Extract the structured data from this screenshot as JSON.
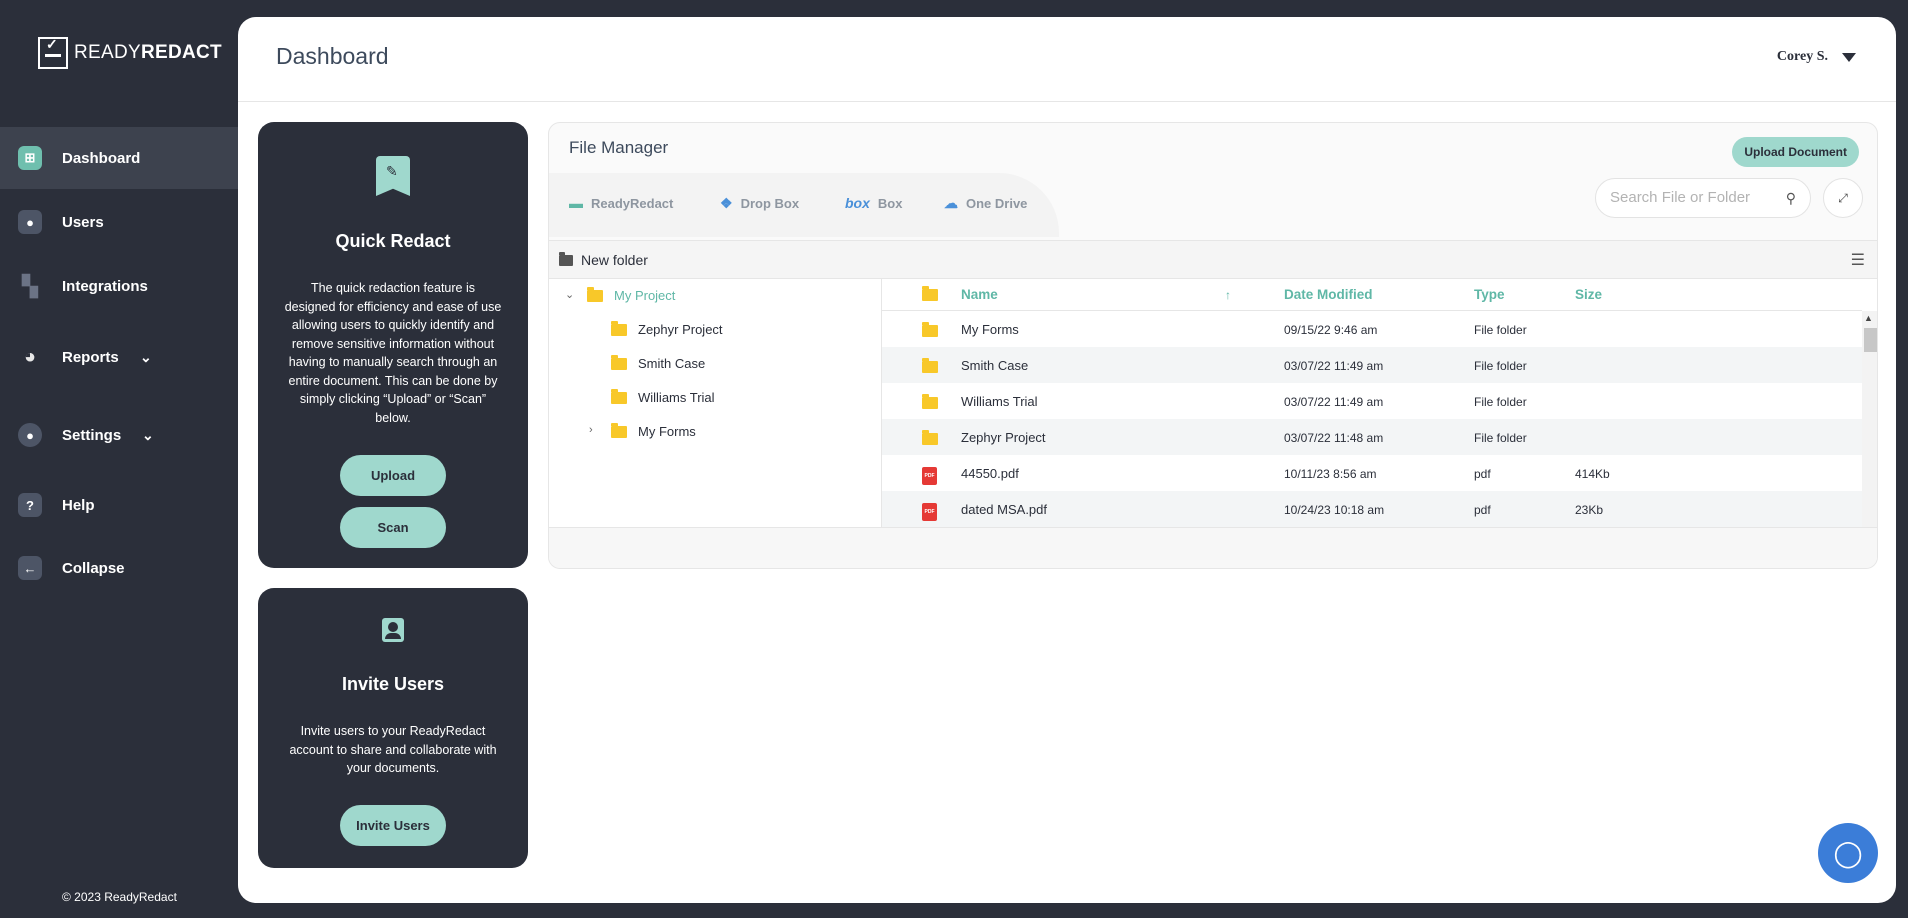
{
  "brand": {
    "name_regular": "READY",
    "name_bold": "REDACT"
  },
  "sidebar": {
    "items": [
      {
        "label": "Dashboard",
        "icon": "dashboard-icon",
        "active": true
      },
      {
        "label": "Users",
        "icon": "users-icon"
      },
      {
        "label": "Integrations",
        "icon": "integrations-icon"
      },
      {
        "label": "Reports",
        "icon": "reports-icon",
        "expandable": true
      },
      {
        "label": "Settings",
        "icon": "settings-icon",
        "expandable": true
      },
      {
        "label": "Help",
        "icon": "help-icon"
      },
      {
        "label": "Collapse",
        "icon": "collapse-icon"
      }
    ],
    "copyright": "© 2023 ReadyRedact"
  },
  "header": {
    "title": "Dashboard",
    "user_name": "Corey S."
  },
  "quick_redact": {
    "title": "Quick Redact",
    "description": "The quick redaction feature is designed for efficiency and ease of use allowing users to quickly identify and remove sensitive information without having to manually search through an entire document. This can be done by simply clicking “Upload” or “Scan” below.",
    "upload_label": "Upload",
    "scan_label": "Scan"
  },
  "invite_users": {
    "title": "Invite Users",
    "description": "Invite users to your ReadyRedact account to share and collaborate with your documents.",
    "button_label": "Invite Users"
  },
  "file_manager": {
    "title": "File Manager",
    "upload_label": "Upload Document",
    "tabs": [
      "ReadyRedact",
      "Drop Box",
      "Box",
      "One Drive"
    ],
    "search_placeholder": "Search File or Folder",
    "new_folder_label": "New folder",
    "tree": {
      "root": "My Project",
      "children": [
        "Zephyr Project",
        "Smith Case",
        "Williams Trial",
        "My Forms"
      ]
    },
    "columns": {
      "name": "Name",
      "date": "Date Modified",
      "type": "Type",
      "size": "Size"
    },
    "rows": [
      {
        "name": "My Forms",
        "date": "09/15/22 9:46 am",
        "type": "File folder",
        "size": "",
        "kind": "folder"
      },
      {
        "name": "Smith Case",
        "date": "03/07/22 11:49 am",
        "type": "File folder",
        "size": "",
        "kind": "folder"
      },
      {
        "name": "Williams Trial",
        "date": "03/07/22 11:49 am",
        "type": "File folder",
        "size": "",
        "kind": "folder"
      },
      {
        "name": "Zephyr Project",
        "date": "03/07/22 11:48 am",
        "type": "File folder",
        "size": "",
        "kind": "folder"
      },
      {
        "name": "44550.pdf",
        "date": "10/11/23 8:56 am",
        "type": "pdf",
        "size": "414Kb",
        "kind": "pdf"
      },
      {
        "name": "dated MSA.pdf",
        "date": "10/24/23 10:18 am",
        "type": "pdf",
        "size": "23Kb",
        "kind": "pdf"
      }
    ]
  },
  "colors": {
    "sidebar_bg": "#2b2f3a",
    "accent": "#9fd8cd",
    "accent_text": "#5fb7a6",
    "folder": "#f8c829",
    "pdf": "#e53935",
    "chat": "#3b7dd8"
  }
}
